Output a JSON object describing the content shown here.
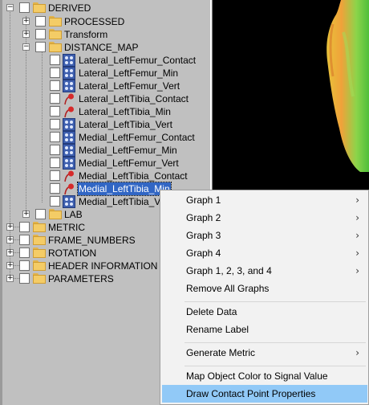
{
  "tree": {
    "top_label": "DERIVED",
    "items": [
      {
        "label": "PROCESSED"
      },
      {
        "label": "Transform"
      },
      {
        "label": "DISTANCE_MAP"
      },
      {
        "label": "Lateral_LeftFemur_Contact"
      },
      {
        "label": "Lateral_LeftFemur_Min"
      },
      {
        "label": "Lateral_LeftFemur_Vert"
      },
      {
        "label": "Lateral_LeftTibia_Contact"
      },
      {
        "label": "Lateral_LeftTibia_Min"
      },
      {
        "label": "Lateral_LeftTibia_Vert"
      },
      {
        "label": "Medial_LeftFemur_Contact"
      },
      {
        "label": "Medial_LeftFemur_Min"
      },
      {
        "label": "Medial_LeftFemur_Vert"
      },
      {
        "label": "Medial_LeftTibia_Contact"
      },
      {
        "label": "Medial_LeftTibia_Min"
      },
      {
        "label": "Medial_LeftTibia_Ve"
      },
      {
        "label": "LAB"
      },
      {
        "label": "METRIC"
      },
      {
        "label": "FRAME_NUMBERS"
      },
      {
        "label": "ROTATION"
      },
      {
        "label": "HEADER INFORMATION"
      },
      {
        "label": "PARAMETERS"
      }
    ]
  },
  "context_menu": {
    "items": [
      {
        "label": "Graph 1"
      },
      {
        "label": "Graph 2"
      },
      {
        "label": "Graph 3"
      },
      {
        "label": "Graph 4"
      },
      {
        "label": "Graph 1, 2, 3, and 4"
      },
      {
        "label": "Remove All Graphs"
      },
      {
        "label": "Delete Data"
      },
      {
        "label": "Rename Label"
      },
      {
        "label": "Generate Metric"
      },
      {
        "label": "Map Object Color to Signal Value"
      },
      {
        "label": "Draw Contact Point Properties"
      }
    ],
    "submenu_arrow": "›"
  },
  "icons": {
    "folder": "folder-icon",
    "signal": "signal-grid-icon",
    "contact": "contact-point-icon",
    "expander_plus": "+",
    "expander_minus": "−"
  },
  "colors": {
    "selection": "#3166c4",
    "menu_highlight": "#91c9f7",
    "viewport_background": "#000000"
  }
}
